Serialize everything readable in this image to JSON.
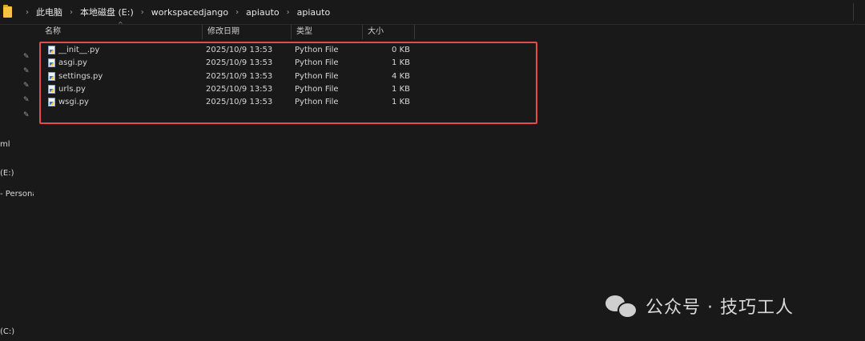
{
  "addressbar": {
    "crumbs": [
      "此电脑",
      "本地磁盘 (E:)",
      "workspacedjango",
      "apiauto",
      "apiauto"
    ]
  },
  "navpane": {
    "pins": [
      "pin-icon",
      "pin-icon",
      "pin-icon",
      "pin-icon",
      "pin-icon"
    ],
    "labels": [
      "ml",
      "(E:)",
      "- Persona",
      "(C:)"
    ]
  },
  "columns": {
    "name": "名称",
    "modified": "修改日期",
    "type": "类型",
    "size": "大小"
  },
  "files": [
    {
      "name": "__init__.py",
      "modified": "2025/10/9 13:53",
      "type": "Python File",
      "size": "0 KB"
    },
    {
      "name": "asgi.py",
      "modified": "2025/10/9 13:53",
      "type": "Python File",
      "size": "1 KB"
    },
    {
      "name": "settings.py",
      "modified": "2025/10/9 13:53",
      "type": "Python File",
      "size": "4 KB"
    },
    {
      "name": "urls.py",
      "modified": "2025/10/9 13:53",
      "type": "Python File",
      "size": "1 KB"
    },
    {
      "name": "wsgi.py",
      "modified": "2025/10/9 13:53",
      "type": "Python File",
      "size": "1 KB"
    }
  ],
  "highlight_color": "#e64b4b",
  "watermark": {
    "text": "公众号 · 技巧工人",
    "icon": "wechat-icon"
  }
}
